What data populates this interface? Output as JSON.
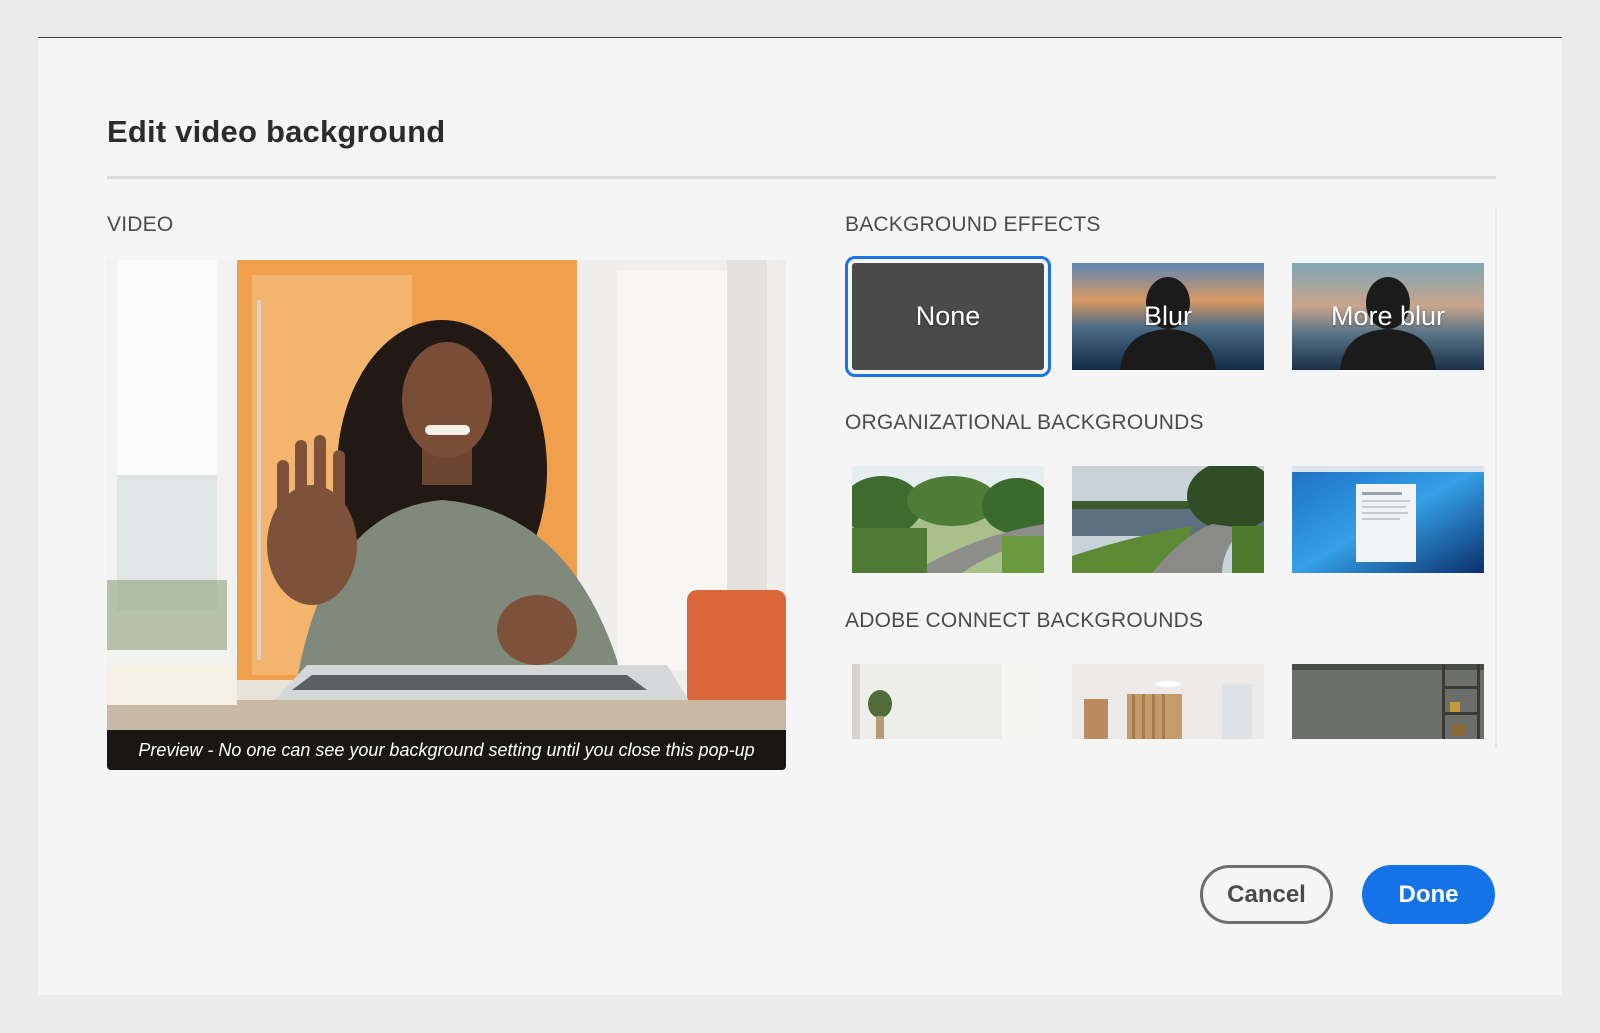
{
  "dialog": {
    "title": "Edit video background"
  },
  "video": {
    "section_label": "VIDEO",
    "preview_caption": "Preview - No one can see your background setting until you close this pop-up"
  },
  "background_effects": {
    "section_label": "BACKGROUND EFFECTS",
    "items": [
      {
        "label": "None",
        "selected": true
      },
      {
        "label": "Blur",
        "selected": false
      },
      {
        "label": "More blur",
        "selected": false
      }
    ]
  },
  "organizational_backgrounds": {
    "section_label": "ORGANIZATIONAL BACKGROUNDS",
    "items": [
      "park-path-image",
      "lake-path-image",
      "blue-desktop-image"
    ]
  },
  "adobe_connect_backgrounds": {
    "section_label": "ADOBE CONNECT BACKGROUNDS",
    "items": [
      "white-room-plant-image",
      "wood-hallway-image",
      "concrete-wall-shelf-image"
    ]
  },
  "buttons": {
    "cancel": "Cancel",
    "done": "Done"
  },
  "colors": {
    "accent": "#1473e6",
    "selected_outline": "#1a73e8",
    "dialog_bg": "#f5f5f5"
  }
}
